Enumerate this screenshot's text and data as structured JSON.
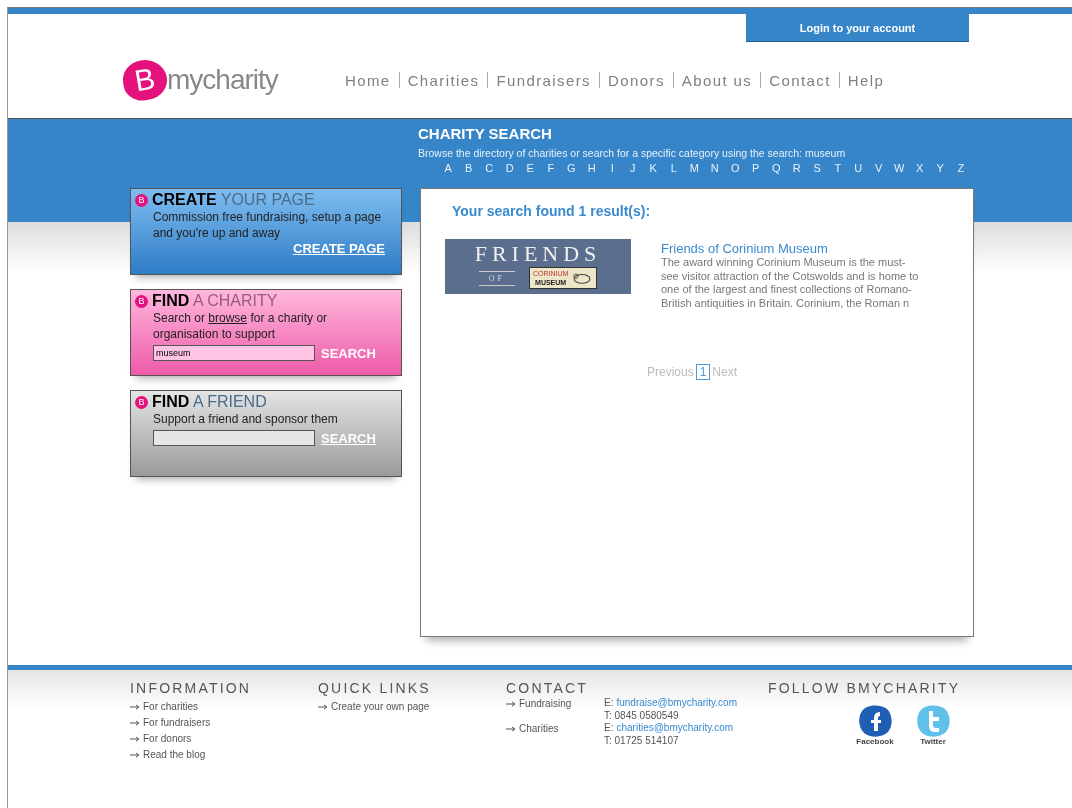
{
  "login": {
    "label": "Login to your account"
  },
  "logo": {
    "letter": "B",
    "text": "mycharity"
  },
  "nav": [
    {
      "label": "Home"
    },
    {
      "label": "Charities"
    },
    {
      "label": "Fundraisers"
    },
    {
      "label": "Donors"
    },
    {
      "label": "About us"
    },
    {
      "label": "Contact"
    },
    {
      "label": "Help"
    }
  ],
  "search_header": {
    "title": "CHARITY SEARCH",
    "description": "Browse the directory of charities or search for a specific category using the search: museum",
    "letters": [
      "A",
      "B",
      "C",
      "D",
      "E",
      "F",
      "G",
      "H",
      "I",
      "J",
      "K",
      "L",
      "M",
      "N",
      "O",
      "P",
      "Q",
      "R",
      "S",
      "T",
      "U",
      "V",
      "W",
      "X",
      "Y",
      "Z"
    ]
  },
  "panels": [
    {
      "kind": "create",
      "badge": "B",
      "title": "**CREATE** YOUR PAGE",
      "text": "Commission free fundraising, setup a page and you're up and away",
      "button": "CREATE PAGE"
    },
    {
      "kind": "charity",
      "badge": "B",
      "title": "**FIND** A CHARITY",
      "text_before": "Search or ",
      "link": "browse",
      "text_after": " for a charity or organisation to support",
      "value": "museum",
      "button": "SEARCH"
    },
    {
      "kind": "friend",
      "badge": "B",
      "title": "**FIND** A FRIEND",
      "text": "Support a friend and sponsor them",
      "button": "SEARCH"
    }
  ],
  "results": {
    "summary": "Your search found 1 result(s):",
    "items": [
      {
        "logo": {
          "line_1": "FRIENDS",
          "line_2": "OF",
          "line_3": "CORINIUM",
          "line_4": "MUSEUM"
        },
        "title": "Friends of Corinium Museum",
        "description": "The award winning Corinium Museum is the must-see visitor attraction of the Cotswolds and is home to one of the largest and finest collections of Romano-British antiquities in Britain. Corinium, the Roman n"
      }
    ],
    "pagination": {
      "previous": "Previous",
      "pages": [
        {
          "label": "1",
          "selected": true
        }
      ],
      "next": "Next"
    }
  },
  "footer": {
    "information": {
      "title": "INFORMATION",
      "links": [
        "For charities",
        "For fundraisers",
        "For donors",
        "Read the blog"
      ]
    },
    "quick_links": {
      "title": "QUICK LINKS",
      "links": [
        "Create your own page"
      ]
    },
    "contact": {
      "title": "CONTACT",
      "entries": [
        {
          "label": "Fundraising",
          "email_prefix": "E: ",
          "email": "fundraise@bmycharity.com",
          "phone": "T: 0845 0580549"
        },
        {
          "label": "Charities",
          "email_prefix": "E: ",
          "email": "charities@bmycharity.com",
          "phone": "T: 01725 514107"
        }
      ]
    },
    "follow": {
      "title": "FOLLOW BMYCHARITY",
      "networks": [
        {
          "kind": "facebook",
          "label": "Facebook"
        },
        {
          "kind": "twitter",
          "label": "Twitter"
        }
      ]
    }
  }
}
